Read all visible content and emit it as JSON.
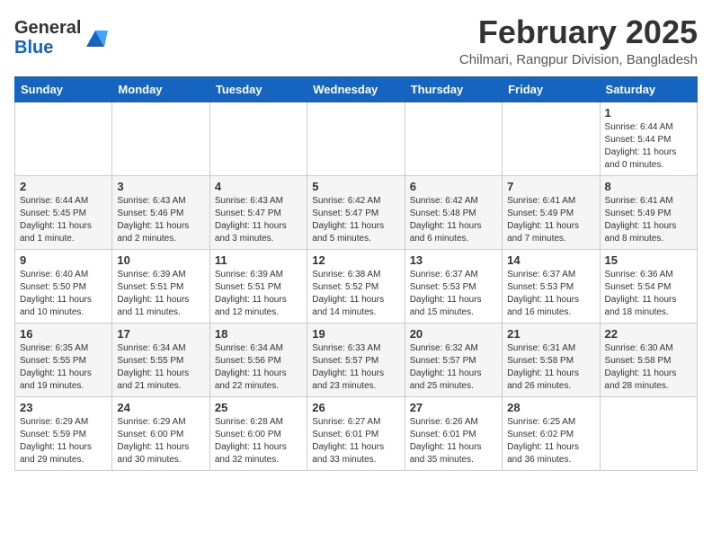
{
  "header": {
    "logo_general": "General",
    "logo_blue": "Blue",
    "month_title": "February 2025",
    "subtitle": "Chilmari, Rangpur Division, Bangladesh"
  },
  "weekdays": [
    "Sunday",
    "Monday",
    "Tuesday",
    "Wednesday",
    "Thursday",
    "Friday",
    "Saturday"
  ],
  "weeks": [
    [
      {
        "day": "",
        "info": ""
      },
      {
        "day": "",
        "info": ""
      },
      {
        "day": "",
        "info": ""
      },
      {
        "day": "",
        "info": ""
      },
      {
        "day": "",
        "info": ""
      },
      {
        "day": "",
        "info": ""
      },
      {
        "day": "1",
        "info": "Sunrise: 6:44 AM\nSunset: 5:44 PM\nDaylight: 11 hours\nand 0 minutes."
      }
    ],
    [
      {
        "day": "2",
        "info": "Sunrise: 6:44 AM\nSunset: 5:45 PM\nDaylight: 11 hours\nand 1 minute."
      },
      {
        "day": "3",
        "info": "Sunrise: 6:43 AM\nSunset: 5:46 PM\nDaylight: 11 hours\nand 2 minutes."
      },
      {
        "day": "4",
        "info": "Sunrise: 6:43 AM\nSunset: 5:47 PM\nDaylight: 11 hours\nand 3 minutes."
      },
      {
        "day": "5",
        "info": "Sunrise: 6:42 AM\nSunset: 5:47 PM\nDaylight: 11 hours\nand 5 minutes."
      },
      {
        "day": "6",
        "info": "Sunrise: 6:42 AM\nSunset: 5:48 PM\nDaylight: 11 hours\nand 6 minutes."
      },
      {
        "day": "7",
        "info": "Sunrise: 6:41 AM\nSunset: 5:49 PM\nDaylight: 11 hours\nand 7 minutes."
      },
      {
        "day": "8",
        "info": "Sunrise: 6:41 AM\nSunset: 5:49 PM\nDaylight: 11 hours\nand 8 minutes."
      }
    ],
    [
      {
        "day": "9",
        "info": "Sunrise: 6:40 AM\nSunset: 5:50 PM\nDaylight: 11 hours\nand 10 minutes."
      },
      {
        "day": "10",
        "info": "Sunrise: 6:39 AM\nSunset: 5:51 PM\nDaylight: 11 hours\nand 11 minutes."
      },
      {
        "day": "11",
        "info": "Sunrise: 6:39 AM\nSunset: 5:51 PM\nDaylight: 11 hours\nand 12 minutes."
      },
      {
        "day": "12",
        "info": "Sunrise: 6:38 AM\nSunset: 5:52 PM\nDaylight: 11 hours\nand 14 minutes."
      },
      {
        "day": "13",
        "info": "Sunrise: 6:37 AM\nSunset: 5:53 PM\nDaylight: 11 hours\nand 15 minutes."
      },
      {
        "day": "14",
        "info": "Sunrise: 6:37 AM\nSunset: 5:53 PM\nDaylight: 11 hours\nand 16 minutes."
      },
      {
        "day": "15",
        "info": "Sunrise: 6:36 AM\nSunset: 5:54 PM\nDaylight: 11 hours\nand 18 minutes."
      }
    ],
    [
      {
        "day": "16",
        "info": "Sunrise: 6:35 AM\nSunset: 5:55 PM\nDaylight: 11 hours\nand 19 minutes."
      },
      {
        "day": "17",
        "info": "Sunrise: 6:34 AM\nSunset: 5:55 PM\nDaylight: 11 hours\nand 21 minutes."
      },
      {
        "day": "18",
        "info": "Sunrise: 6:34 AM\nSunset: 5:56 PM\nDaylight: 11 hours\nand 22 minutes."
      },
      {
        "day": "19",
        "info": "Sunrise: 6:33 AM\nSunset: 5:57 PM\nDaylight: 11 hours\nand 23 minutes."
      },
      {
        "day": "20",
        "info": "Sunrise: 6:32 AM\nSunset: 5:57 PM\nDaylight: 11 hours\nand 25 minutes."
      },
      {
        "day": "21",
        "info": "Sunrise: 6:31 AM\nSunset: 5:58 PM\nDaylight: 11 hours\nand 26 minutes."
      },
      {
        "day": "22",
        "info": "Sunrise: 6:30 AM\nSunset: 5:58 PM\nDaylight: 11 hours\nand 28 minutes."
      }
    ],
    [
      {
        "day": "23",
        "info": "Sunrise: 6:29 AM\nSunset: 5:59 PM\nDaylight: 11 hours\nand 29 minutes."
      },
      {
        "day": "24",
        "info": "Sunrise: 6:29 AM\nSunset: 6:00 PM\nDaylight: 11 hours\nand 30 minutes."
      },
      {
        "day": "25",
        "info": "Sunrise: 6:28 AM\nSunset: 6:00 PM\nDaylight: 11 hours\nand 32 minutes."
      },
      {
        "day": "26",
        "info": "Sunrise: 6:27 AM\nSunset: 6:01 PM\nDaylight: 11 hours\nand 33 minutes."
      },
      {
        "day": "27",
        "info": "Sunrise: 6:26 AM\nSunset: 6:01 PM\nDaylight: 11 hours\nand 35 minutes."
      },
      {
        "day": "28",
        "info": "Sunrise: 6:25 AM\nSunset: 6:02 PM\nDaylight: 11 hours\nand 36 minutes."
      },
      {
        "day": "",
        "info": ""
      }
    ]
  ]
}
